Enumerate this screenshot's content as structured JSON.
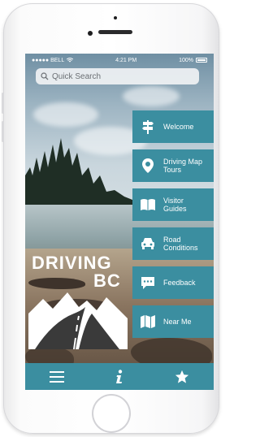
{
  "status_bar": {
    "carrier": "●●●●● BELL",
    "time": "4:21 PM",
    "battery": "100%"
  },
  "search": {
    "placeholder": "Quick Search"
  },
  "menu": [
    {
      "label": "Welcome",
      "icon": "signpost-icon"
    },
    {
      "label": "Driving Map\nTours",
      "icon": "map-pin-icon"
    },
    {
      "label": "Visitor\nGuides",
      "icon": "book-icon"
    },
    {
      "label": "Road\nConditions",
      "icon": "car-icon"
    },
    {
      "label": "Feedback",
      "icon": "chat-icon"
    },
    {
      "label": "Near Me",
      "icon": "map-icon"
    }
  ],
  "brand": {
    "line1": "DRIVING",
    "line2": "BC"
  },
  "tabbar": [
    {
      "icon": "menu-icon"
    },
    {
      "icon": "info-icon"
    },
    {
      "icon": "star-icon"
    }
  ],
  "colors": {
    "accent": "#3b8ea0"
  }
}
